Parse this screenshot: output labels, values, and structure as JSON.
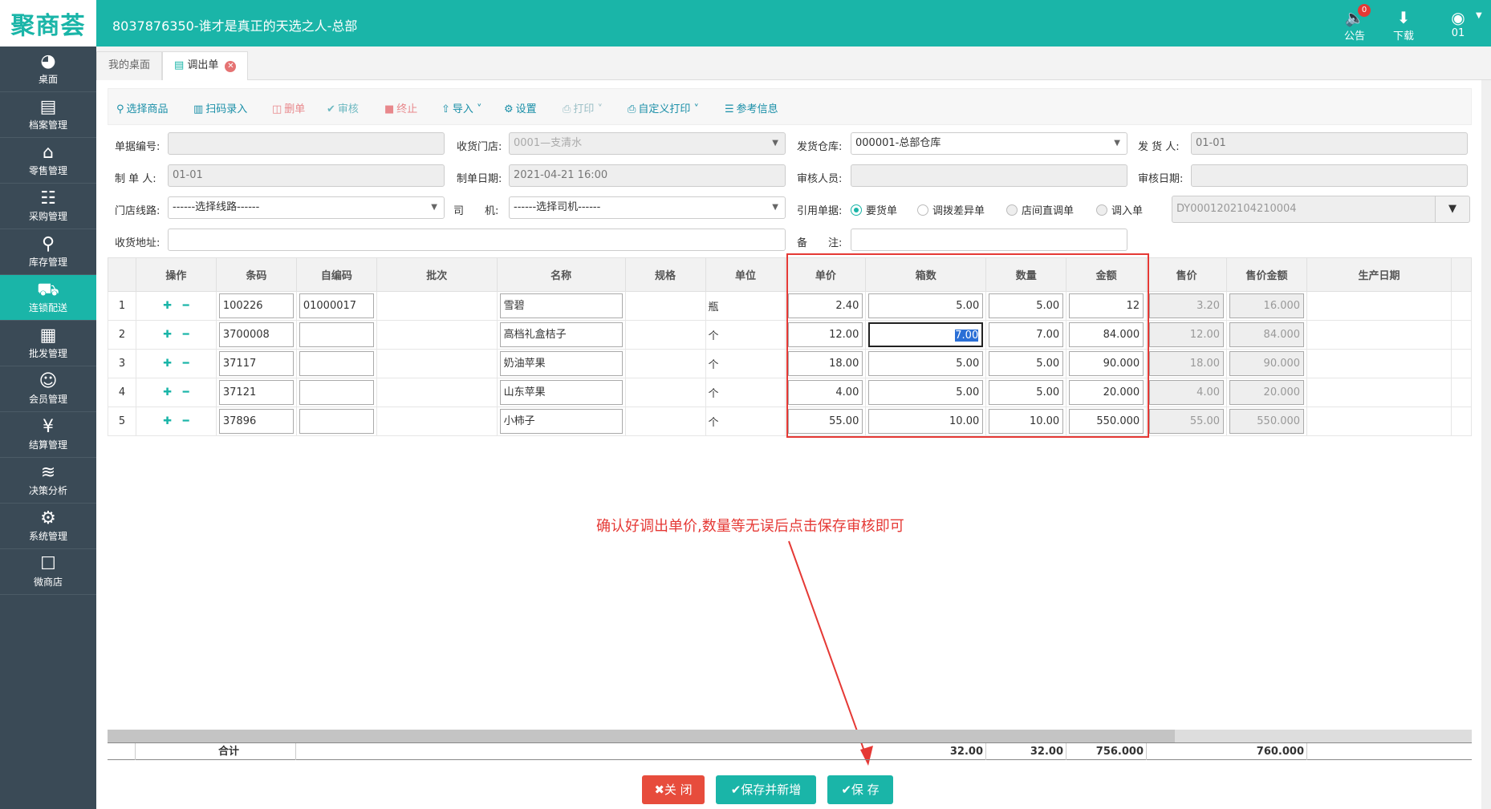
{
  "app": {
    "logo": "聚商荟",
    "title": "8037876350-谁才是真正的天选之人-总部",
    "announce_label": "公告",
    "announce_badge": "0",
    "download_label": "下载",
    "user_label": "01"
  },
  "sidebar": {
    "items": [
      {
        "label": "桌面",
        "icon": "dashboard-icon"
      },
      {
        "label": "档案管理",
        "icon": "file-icon"
      },
      {
        "label": "零售管理",
        "icon": "store-icon"
      },
      {
        "label": "采购管理",
        "icon": "cart-icon"
      },
      {
        "label": "库存管理",
        "icon": "inventory-icon"
      },
      {
        "label": "连锁配送",
        "icon": "truck-icon",
        "active": true
      },
      {
        "label": "批发管理",
        "icon": "wholesale-icon"
      },
      {
        "label": "会员管理",
        "icon": "member-icon"
      },
      {
        "label": "结算管理",
        "icon": "yen-icon"
      },
      {
        "label": "决策分析",
        "icon": "chart-icon"
      },
      {
        "label": "系统管理",
        "icon": "gear-icon"
      },
      {
        "label": "微商店",
        "icon": "bag-icon"
      }
    ]
  },
  "tabs": [
    {
      "label": "我的桌面"
    },
    {
      "label": "调出单",
      "active": true
    }
  ],
  "toolbar": {
    "select_goods": "选择商品",
    "scan": "扫码录入",
    "delete": "删单",
    "audit": "审核",
    "terminate": "终止",
    "import": "导入",
    "settings": "设置",
    "print": "打印",
    "custom_print": "自定义打印",
    "reference": "参考信息"
  },
  "form": {
    "doc_no_label": "单据编号:",
    "doc_no": "",
    "receive_store_label": "收货门店:",
    "receive_store": "0001—支清水",
    "ship_wh_label": "发货仓库:",
    "ship_wh": "000001-总部仓库",
    "shipper_label": "发 货 人:",
    "shipper": "01-01",
    "maker_label": "制 单 人:",
    "maker": "01-01",
    "make_date_label": "制单日期:",
    "make_date": "2021-04-21 16:00",
    "auditor_label": "审核人员:",
    "auditor": "",
    "audit_date_label": "审核日期:",
    "audit_date": "",
    "route_label": "门店线路:",
    "route": "------选择线路------",
    "driver_label": "司　　机:",
    "driver": "------选择司机------",
    "ref_label": "引用单据:",
    "ref_options": [
      "要货单",
      "调拨差异单",
      "店间直调单",
      "调入单"
    ],
    "ref_no": "DY0001202104210004",
    "address_label": "收货地址:",
    "address": "",
    "remark_label": "备　　注:",
    "remark": ""
  },
  "grid": {
    "headers": [
      "操作",
      "条码",
      "自编码",
      "批次",
      "名称",
      "规格",
      "单位",
      "单价",
      "箱数",
      "数量",
      "金额",
      "售价",
      "售价金额",
      "生产日期"
    ],
    "rows": [
      {
        "no": "1",
        "barcode": "100226",
        "code": "01000017",
        "name": "雪碧",
        "unit": "瓶",
        "price": "2.40",
        "boxes": "5.00",
        "qty": "5.00",
        "amount": "12",
        "sale_price": "3.20",
        "sale_amount": "16.000"
      },
      {
        "no": "2",
        "barcode": "3700008",
        "code": "",
        "name": "高档礼盒桔子",
        "unit": "个",
        "price": "12.00",
        "boxes": "7.00",
        "qty": "7.00",
        "amount": "84.000",
        "sale_price": "12.00",
        "sale_amount": "84.000"
      },
      {
        "no": "3",
        "barcode": "37117",
        "code": "",
        "name": "奶油苹果",
        "unit": "个",
        "price": "18.00",
        "boxes": "5.00",
        "qty": "5.00",
        "amount": "90.000",
        "sale_price": "18.00",
        "sale_amount": "90.000"
      },
      {
        "no": "4",
        "barcode": "37121",
        "code": "",
        "name": "山东苹果",
        "unit": "个",
        "price": "4.00",
        "boxes": "5.00",
        "qty": "5.00",
        "amount": "20.000",
        "sale_price": "4.00",
        "sale_amount": "20.000"
      },
      {
        "no": "5",
        "barcode": "37896",
        "code": "",
        "name": "小柿子",
        "unit": "个",
        "price": "55.00",
        "boxes": "10.00",
        "qty": "10.00",
        "amount": "550.000",
        "sale_price": "55.00",
        "sale_amount": "550.000"
      }
    ],
    "totals": {
      "label": "合计",
      "boxes": "32.00",
      "qty": "32.00",
      "amount": "756.000",
      "sale_amount": "760.000"
    }
  },
  "annotation": "确认好调出单价,数量等无误后点击保存审核即可",
  "buttons": {
    "close": "关 闭",
    "save_new": "保存并新增",
    "save": "保 存"
  },
  "colors": {
    "accent": "#1ab5a8",
    "sidebar": "#3a4a56",
    "danger": "#e74c3c"
  }
}
